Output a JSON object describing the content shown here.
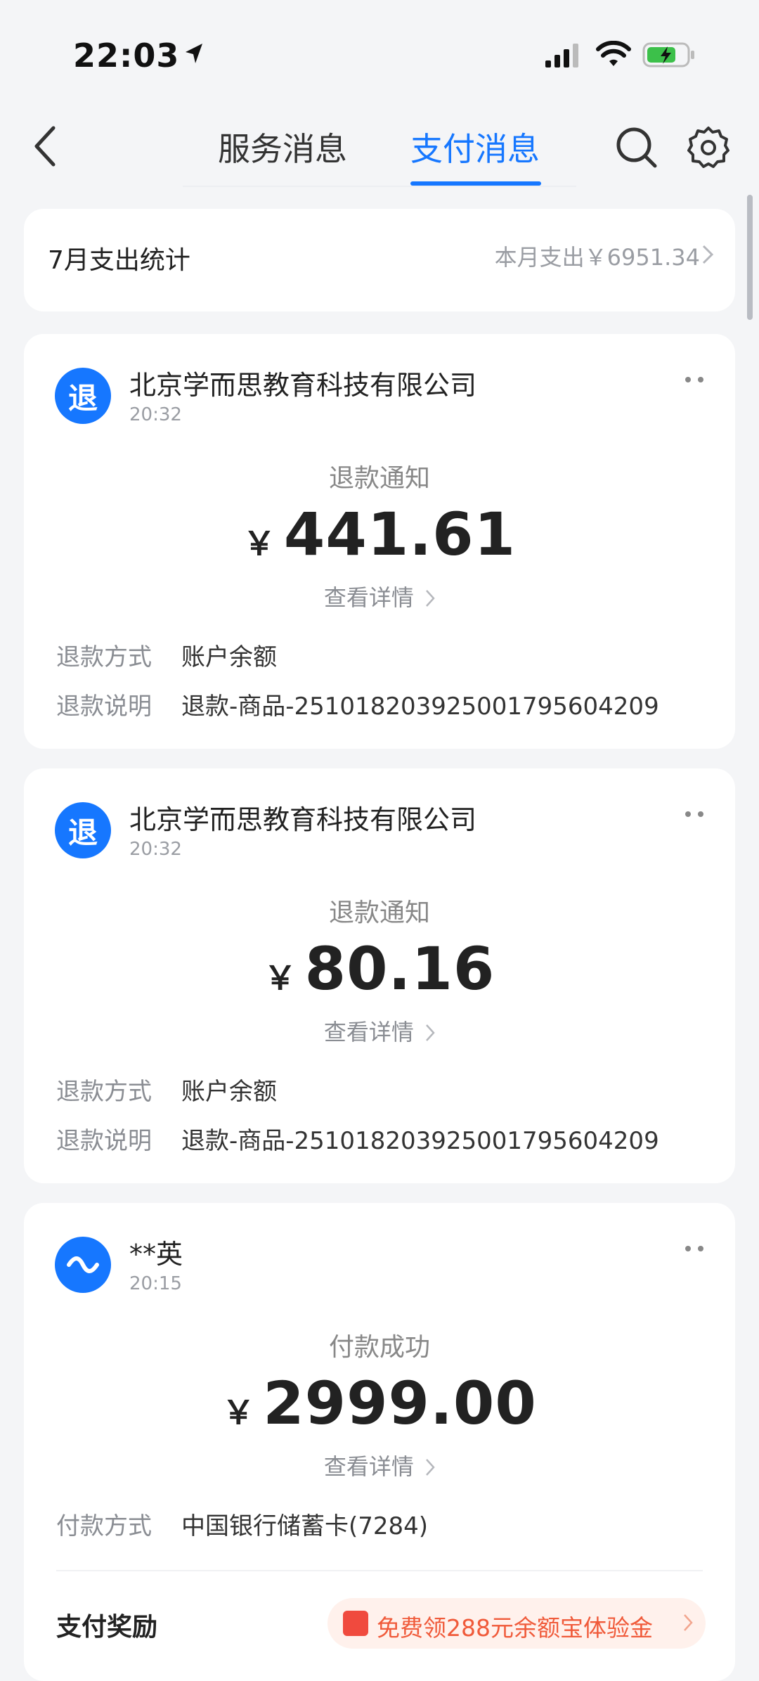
{
  "status_bar": {
    "time": "22:03"
  },
  "nav": {
    "tabs": [
      {
        "label": "服务消息",
        "active": false
      },
      {
        "label": "支付消息",
        "active": true
      }
    ],
    "accent_color": "#1677ff"
  },
  "stats": {
    "title": "7月支出统计",
    "summary": "本月支出￥6951.34"
  },
  "messages": [
    {
      "avatar_text": "退",
      "merchant": "北京学而思教育科技有限公司",
      "time": "20:32",
      "type": "退款通知",
      "currency": "￥",
      "amount": "441.61",
      "detail_link": "查看详情",
      "rows": [
        {
          "label": "退款方式",
          "value": "账户余额"
        },
        {
          "label": "退款说明",
          "value": "退款-商品-2510182039250017956042​09"
        }
      ]
    },
    {
      "avatar_text": "退",
      "merchant": "北京学而思教育科技有限公司",
      "time": "20:32",
      "type": "退款通知",
      "currency": "￥",
      "amount": "80.16",
      "detail_link": "查看详情",
      "rows": [
        {
          "label": "退款方式",
          "value": "账户余额"
        },
        {
          "label": "退款说明",
          "value": "退款-商品-251018203925001795604209"
        }
      ]
    },
    {
      "avatar_icon": "transfer-icon",
      "merchant": "**英",
      "time": "20:15",
      "type": "付款成功",
      "currency": "￥",
      "amount": "2999.00",
      "detail_link": "查看详情",
      "rows": [
        {
          "label": "付款方式",
          "value": "中国银行储蓄卡(7284)"
        }
      ],
      "reward": {
        "label": "支付奖励",
        "promo": "免费领288元余额宝体验金"
      }
    }
  ]
}
